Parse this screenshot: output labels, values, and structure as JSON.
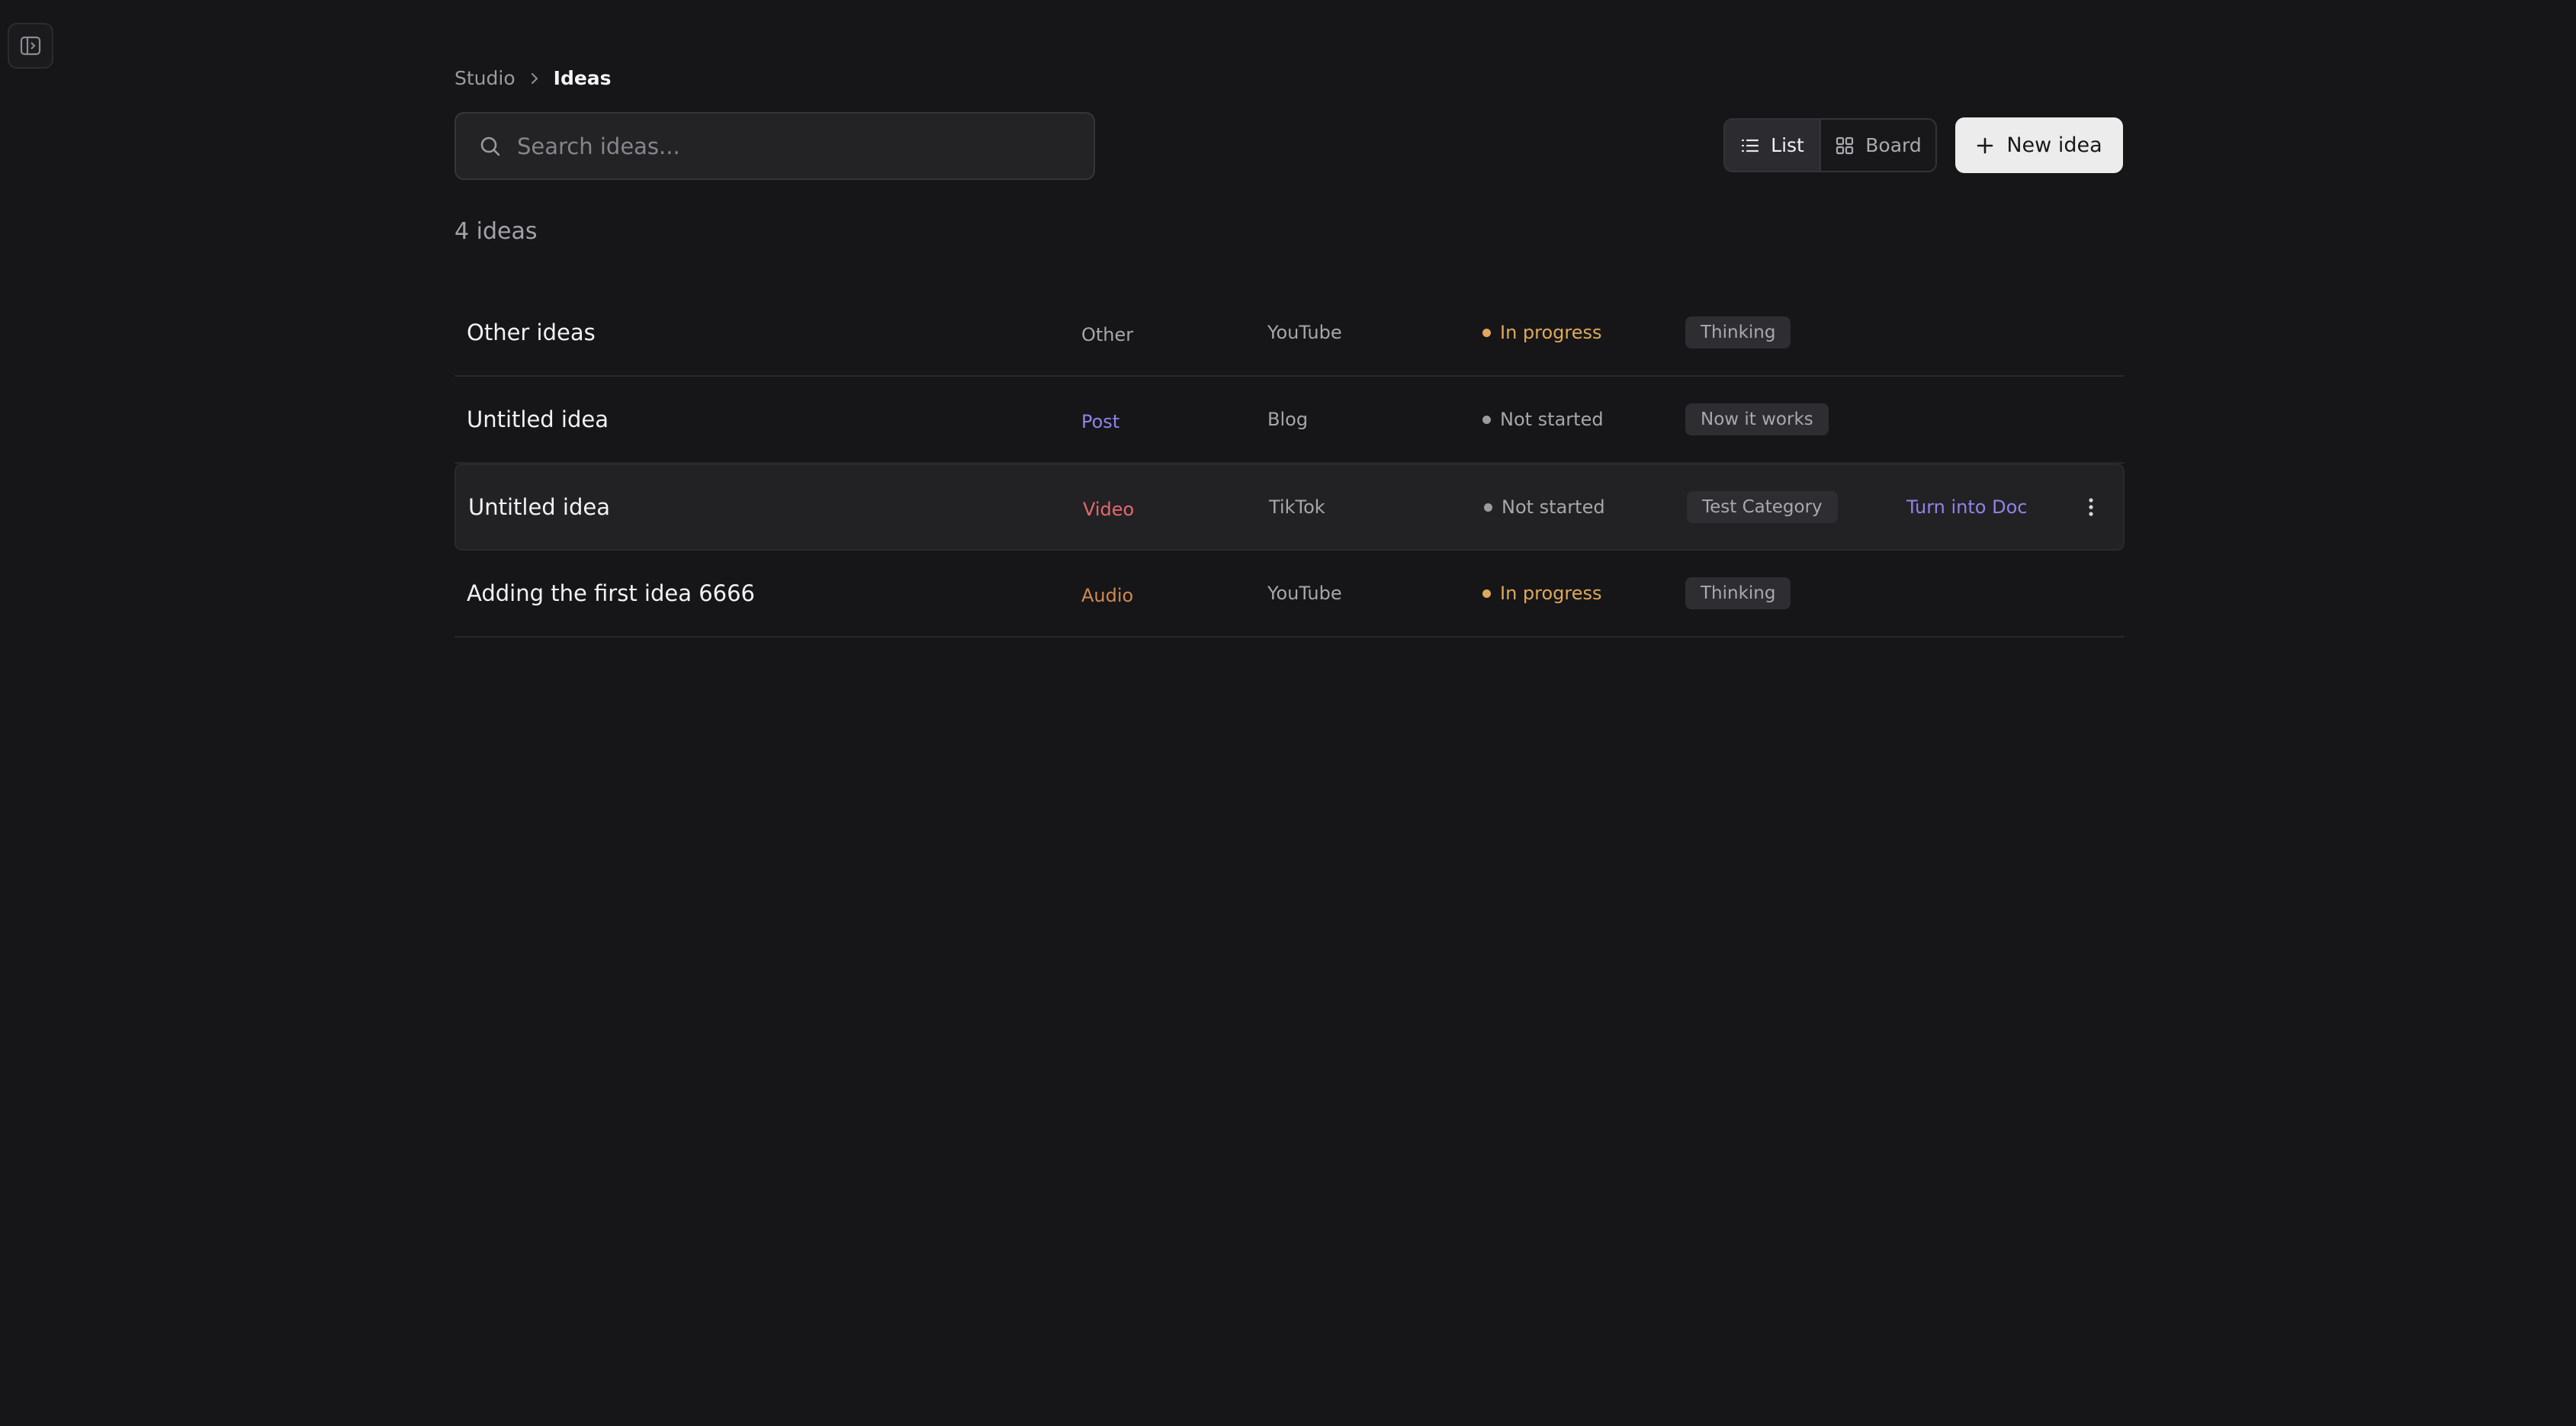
{
  "breadcrumb": {
    "parent": "Studio",
    "current": "Ideas"
  },
  "search": {
    "placeholder": "Search ideas...",
    "value": ""
  },
  "view_toggle": {
    "list_label": "List",
    "board_label": "Board",
    "selected": "List"
  },
  "new_button": {
    "label": "New idea"
  },
  "count_label": "4 ideas",
  "colors": {
    "in_progress": "#e0a85a",
    "not_started": "#9a9aa0",
    "type_other": "#a6a6ab",
    "type_post": "#8f84e8",
    "type_video": "#e5686c",
    "type_audio": "#d0884f",
    "action_link": "#8f84e8"
  },
  "ideas": [
    {
      "title": "Other ideas",
      "type": "Other",
      "platform": "YouTube",
      "status": "In progress",
      "category": "Thinking"
    },
    {
      "title": "Untitled idea",
      "type": "Post",
      "platform": "Blog",
      "status": "Not started",
      "category": "Now it works"
    },
    {
      "title": "Untitled idea",
      "type": "Video",
      "platform": "TikTok",
      "status": "Not started",
      "category": "Test Category",
      "action": "Turn into Doc"
    },
    {
      "title": "Adding the first idea 6666",
      "type": "Audio",
      "platform": "YouTube",
      "status": "In progress",
      "category": "Thinking"
    }
  ]
}
